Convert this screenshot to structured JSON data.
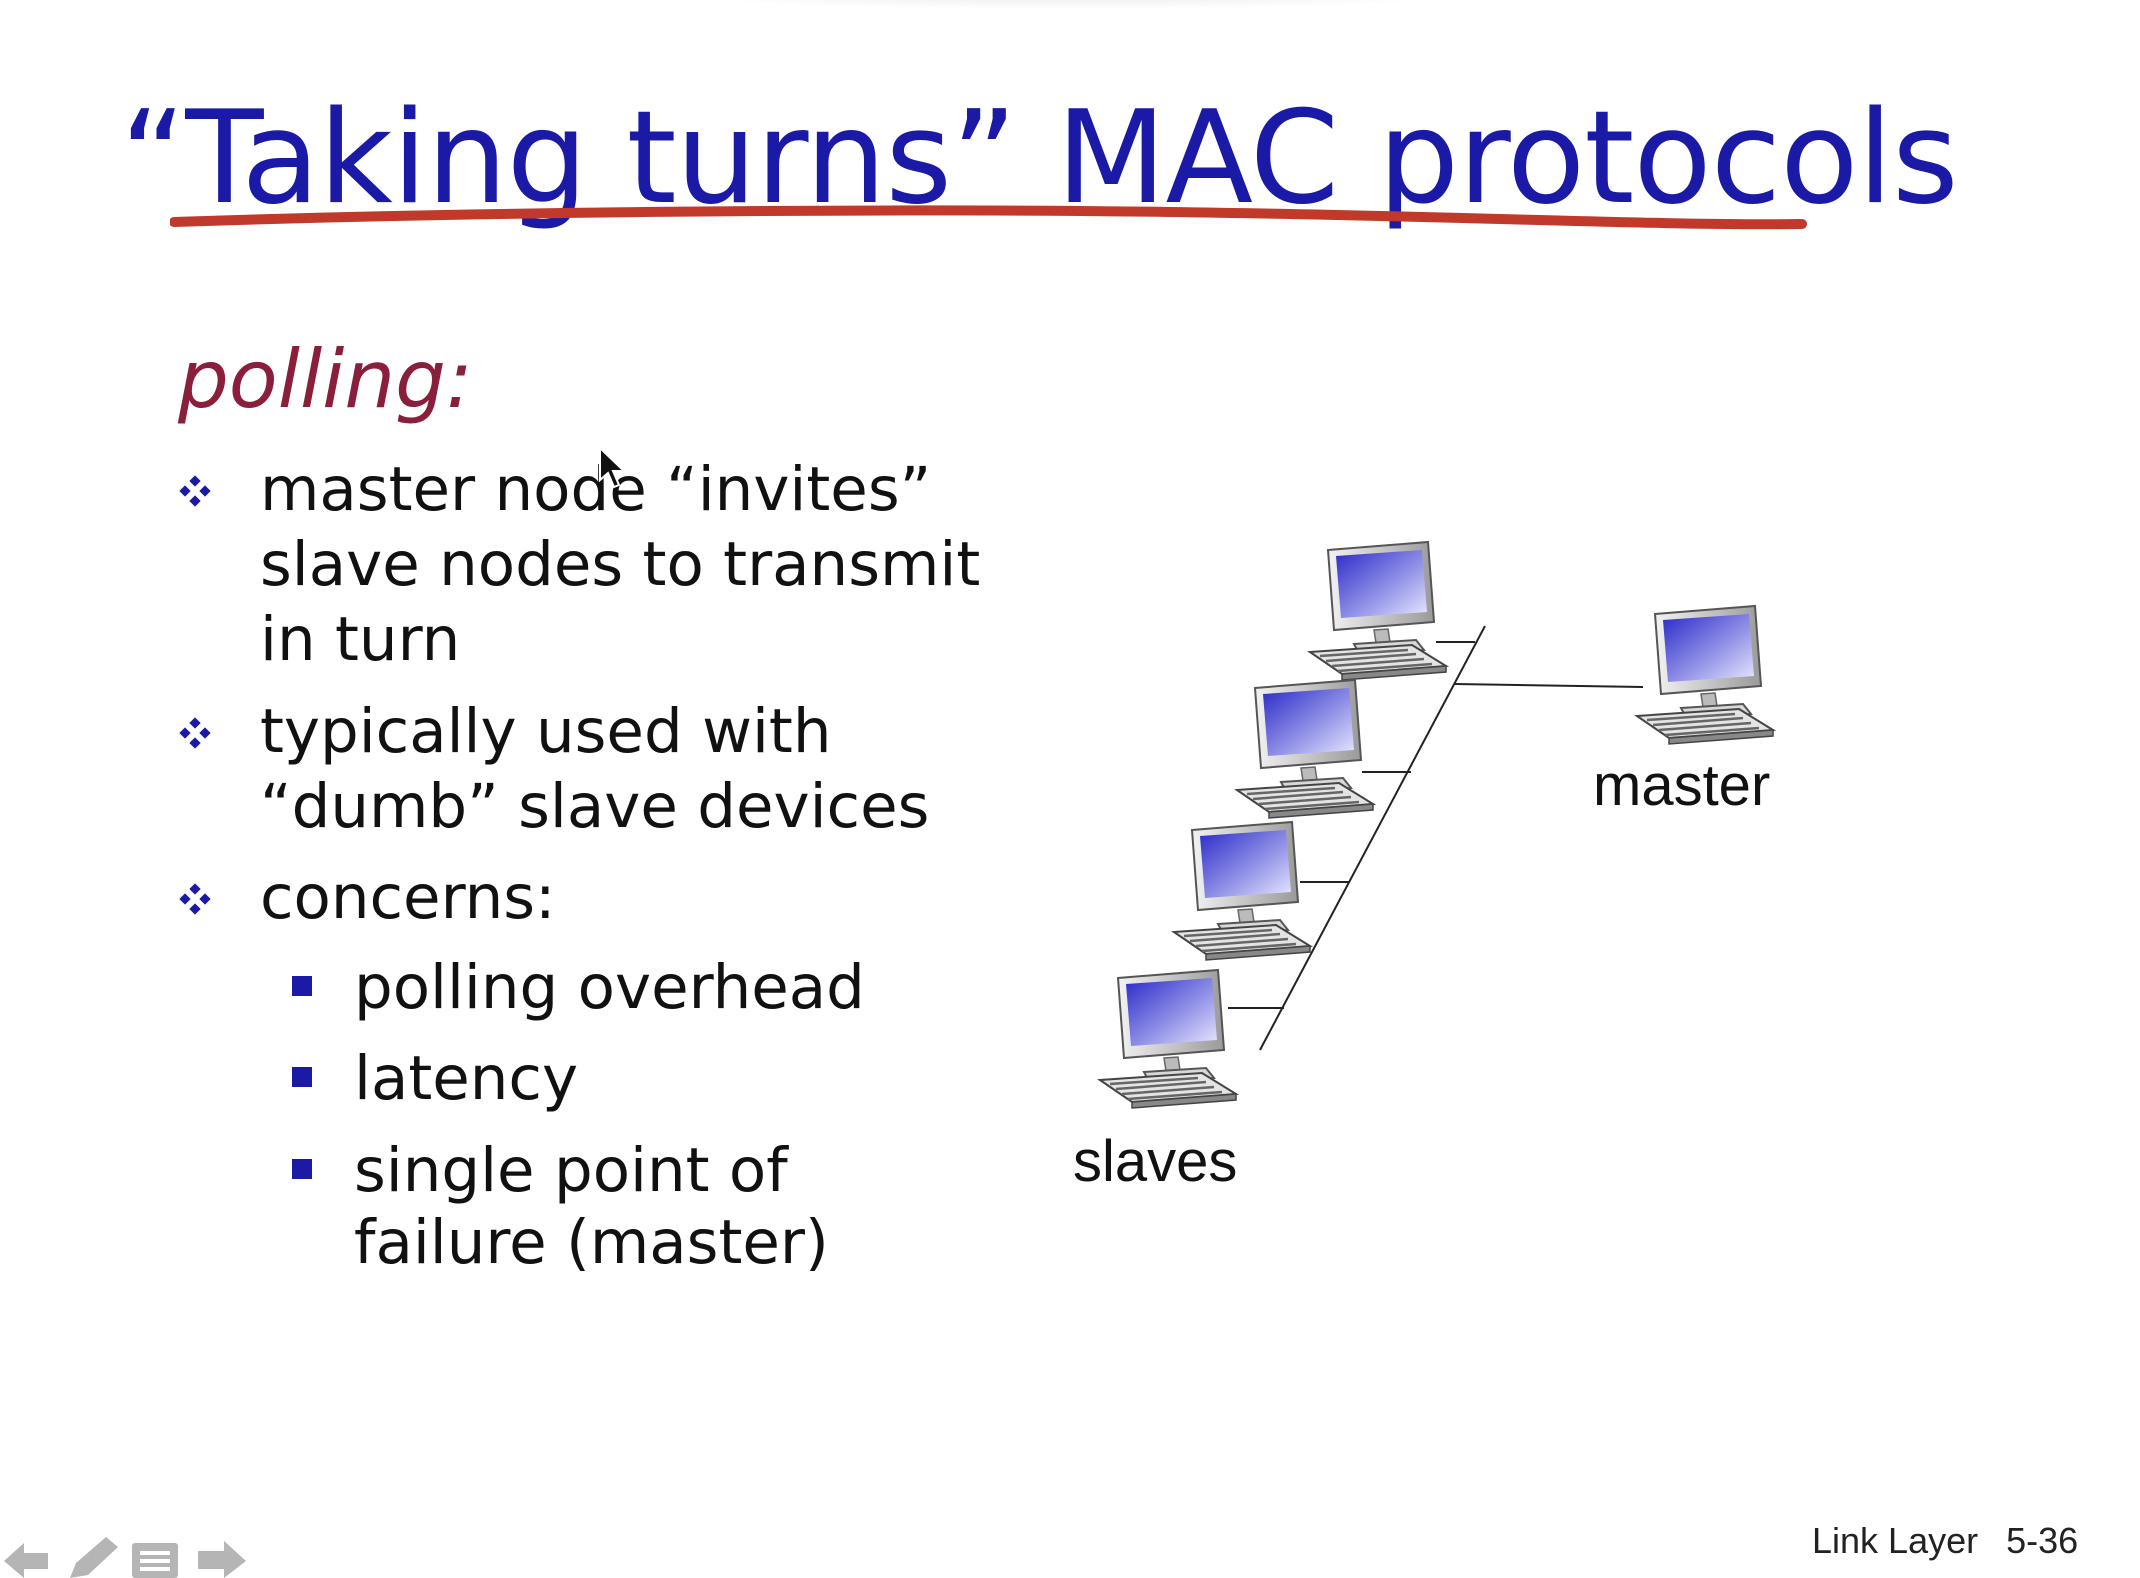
{
  "slide": {
    "title": "“Taking turns” MAC protocols",
    "section_label": "polling:",
    "bullets": [
      {
        "lines": [
          "master node “invites”",
          "slave nodes to transmit",
          "in turn"
        ]
      },
      {
        "lines": [
          "typically used with",
          "“dumb” slave devices"
        ]
      },
      {
        "lines": [
          "concerns:"
        ]
      }
    ],
    "sub_bullets": [
      {
        "lines": [
          "polling overhead"
        ]
      },
      {
        "lines": [
          "latency"
        ]
      },
      {
        "lines": [
          "single point of",
          "failure (master)"
        ]
      }
    ]
  },
  "diagram": {
    "master_label": "master",
    "slaves_label": "slaves"
  },
  "footer": {
    "chapter": "Link Layer",
    "page": "5-36"
  },
  "colors": {
    "title": "#1a1aa6",
    "title_underline": "#c0392b",
    "section_label": "#8a1f3c",
    "bullet_marker": "#1a1aa6",
    "text": "#111111"
  },
  "nav_icons": [
    "arrow-left-icon",
    "pencil-icon",
    "menu-icon",
    "arrow-right-icon"
  ]
}
